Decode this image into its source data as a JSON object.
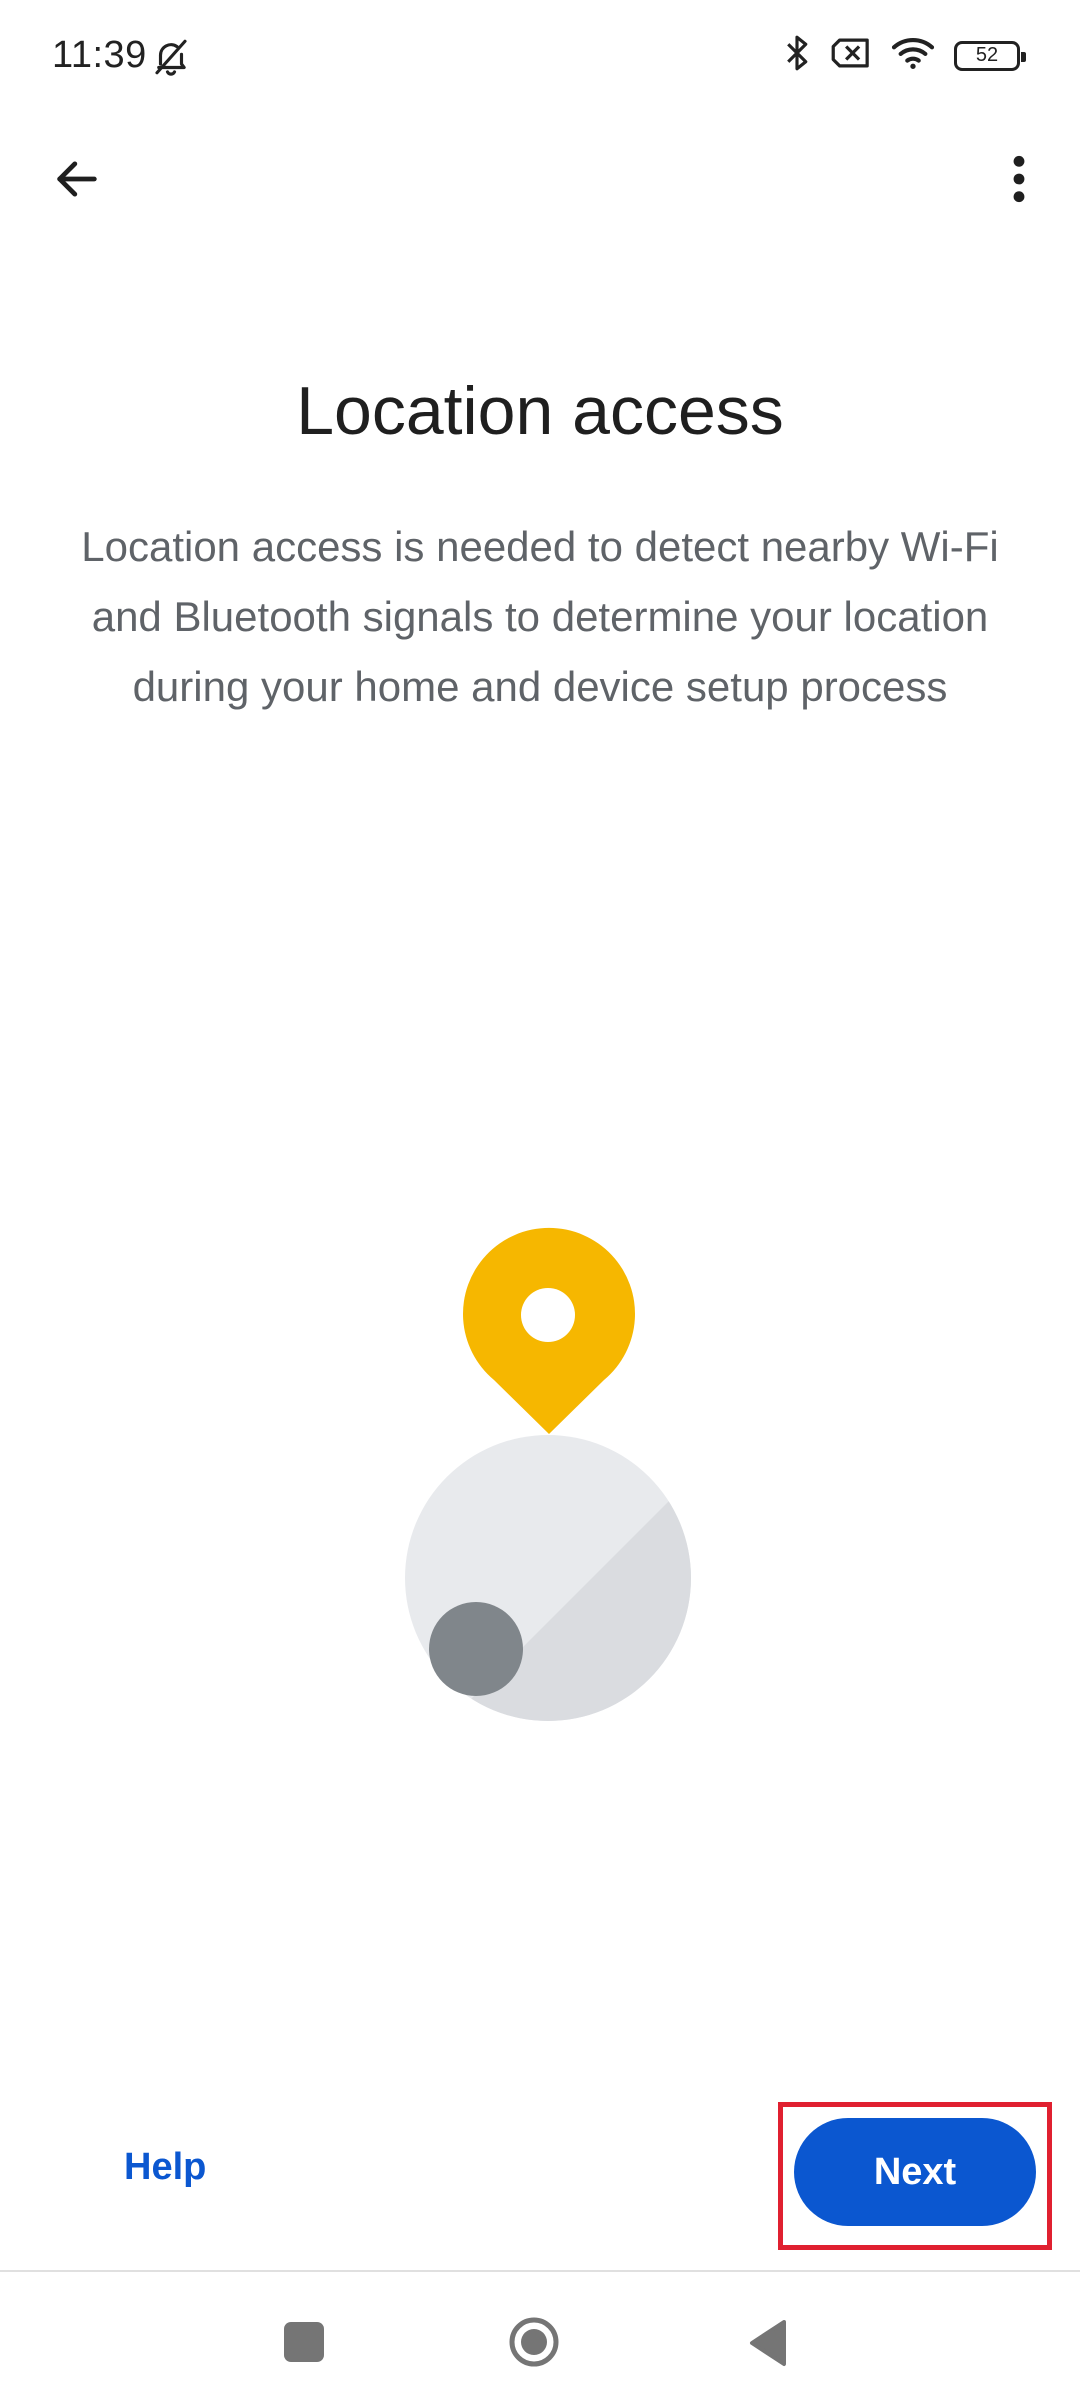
{
  "status_bar": {
    "time": "11:39",
    "battery_level": "52",
    "icons": [
      "bell-off-icon",
      "bluetooth-icon",
      "no-sim-icon",
      "wifi-icon",
      "battery-icon"
    ]
  },
  "toolbar": {
    "back_icon": "arrow-back-icon",
    "more_icon": "more-vert-icon"
  },
  "content": {
    "title": "Location access",
    "description": "Location access is needed to detect nearby Wi-Fi and Bluetooth signals to determine your location during your home and device setup process"
  },
  "illustration": {
    "pin_color": "#F6B700",
    "globe_color": "#E8EAED",
    "dot_color": "#80868B"
  },
  "actions": {
    "help_label": "Help",
    "next_label": "Next",
    "accent_color": "#0B57D0"
  },
  "nav_bar": {
    "icons": [
      "recents-icon",
      "home-icon",
      "back-icon"
    ]
  }
}
